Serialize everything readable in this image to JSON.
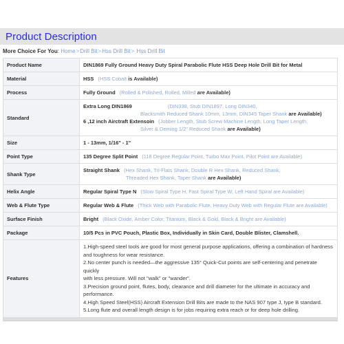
{
  "section": {
    "title": "Product Description"
  },
  "breadcrumb": {
    "label": "More Choice For You",
    "colon": ":",
    "separator": ">",
    "items": [
      {
        "label": "Home"
      },
      {
        "label": "Drill Bit"
      },
      {
        "label": "Hss Drill Bit"
      },
      {
        "label": "Hss Drill Bit"
      }
    ]
  },
  "colors": {
    "title_blue": "#2b2bdd",
    "link_blue": "#7b9bd1",
    "option_blue": "#8fa8cf",
    "header_band": "#e3e3e3",
    "label_cell": "#f1f3f6",
    "border": "#dddddd"
  },
  "spec": {
    "rows": [
      {
        "label": "Product Name",
        "main": "DIN1869 Fully Ground Heavy Duty Spiral Parabolic Flute HSS Deep Hole Drill Bit for Metal",
        "option": ""
      },
      {
        "label": "Material",
        "main": "HSS",
        "option": "(HSS Cobalt",
        "option_tail": "is Available)"
      },
      {
        "label": "Process",
        "main": "Fully Ground",
        "option": "(Rolled & Polished, Rolled, Milled",
        "option_tail": "are Available)"
      },
      {
        "label": "Standard",
        "line1_main": "Extra Long DIN1869",
        "line1_option": "(DIN338, Stub DIN1897, Long DIN340,",
        "line2_option": "Blacksmith Reduced Shank 10mm, 13mm, DIN345 Taper Shank",
        "line2_tail": "are Available)",
        "line3_main": "6 ,12 inch Airctraft Extensoin",
        "line3_option": "(Jobber Length, Stub Screw Machine Length, Long Taper Length,",
        "line4_option": "Silver & Deming 1/2\" Reduced Shank",
        "line4_tail": "are Available)"
      },
      {
        "label": "Size",
        "main": "1 - 13mm, 1/16\" - 1\"",
        "option": ""
      },
      {
        "label": "Point Type",
        "main": "135 Degree Split Point",
        "option": "(118 Degree Regular Point, Turbo Max Point, Pilot Point are Available)"
      },
      {
        "label": "Shank Type",
        "main": "Straight Shank",
        "option": "(Hex Shank, Tri-Flats Shank, Double R Hex Shank, Reduced Shank,",
        "option_line2": "Threaded Hex Shank, Taper Shank",
        "option_line2_tail": "are Available)"
      },
      {
        "label": "Helix Angle",
        "main": "Regular Spiral Type N",
        "option": "(Slow Spiral Type H, Fast Spiral Type W, Left Hand Spiral are Available)"
      },
      {
        "label": "Web & Flute Type",
        "main": "Regular Web & Flute",
        "option": "(Thick Web with Parabolic Flute, Heavy Duty Web with Regular Flute are Available)"
      },
      {
        "label": "Surface Finish",
        "main": "Bright",
        "option": "(Black Oxide, Amber Color, Titanium, Black & Gold, Black & Bright are Available)"
      },
      {
        "label": "Package",
        "main": "10/5 Pcs in PVC Pouch, Plastic Box, Individually in Skin Card, Double Blister, Clamshell.",
        "option": ""
      }
    ],
    "features": {
      "label": "Features",
      "lines": [
        "1.High-speed steel tools are good for most general purpose applications, offering a combination of hardness",
        "and toughness for wear resistance.",
        "2.No center punch is needed—the aggressive 135° Quick-Cut points are self-centering and penetrate quickly",
        "with less pressure. Will not \"walk\" or \"wander\".",
        "3.Precision ground point, flutes, body, clearance and drill diameter for the ultimate in accuracy and performance.",
        "4.High Speed Steel(HSS) Aircraft Extension Drill Bits are made to the NAS 907 type J, type B standard.",
        "5.Long flute and overall length design is for jobs requiring extra reach or for deep hole drilling."
      ]
    }
  }
}
